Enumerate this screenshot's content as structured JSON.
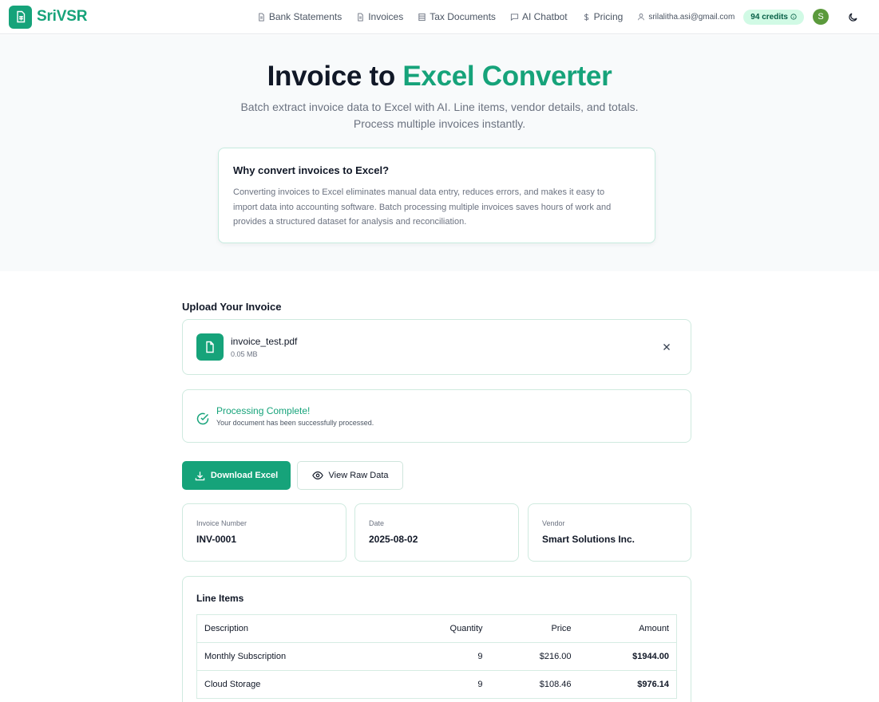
{
  "brand": {
    "name": "SriVSR"
  },
  "nav": {
    "links": [
      {
        "label": "Bank Statements",
        "icon": "document-icon"
      },
      {
        "label": "Invoices",
        "icon": "document-icon"
      },
      {
        "label": "Tax Documents",
        "icon": "table-icon"
      },
      {
        "label": "AI Chatbot",
        "icon": "chat-icon"
      },
      {
        "label": "Pricing",
        "icon": "dollar-icon"
      }
    ],
    "user_email": "srilalitha.asi@gmail.com",
    "credits": "94 credits",
    "avatar_initial": "S"
  },
  "hero": {
    "title_prefix": "Invoice to ",
    "title_accent": "Excel Converter",
    "subtitle_line1": "Batch extract invoice data to Excel with AI. Line items, vendor details, and totals.",
    "subtitle_line2": "Process multiple invoices instantly."
  },
  "why": {
    "title": "Why convert invoices to Excel?",
    "line1": "Converting invoices to Excel eliminates manual data entry, reduces errors, and makes it easy to",
    "line2": "import data into accounting software. Batch processing multiple invoices saves hours of work and",
    "line3": "provides a structured dataset for analysis and reconciliation."
  },
  "upload": {
    "label": "Upload Your Invoice",
    "file_name": "invoice_test.pdf",
    "file_size": "0.05 MB"
  },
  "status": {
    "title": "Processing Complete!",
    "description": "Your document has been successfully processed."
  },
  "actions": {
    "download_label": "Download Excel",
    "view_raw_label": "View Raw Data"
  },
  "invoice": {
    "number_label": "Invoice Number",
    "number": "INV-0001",
    "date_label": "Date",
    "date": "2025-08-02",
    "vendor_label": "Vendor",
    "vendor": "Smart Solutions Inc."
  },
  "line_items": {
    "title": "Line Items",
    "headers": [
      "Description",
      "Quantity",
      "Price",
      "Amount"
    ],
    "rows": [
      [
        "Monthly Subscription",
        "9",
        "$216.00",
        "$1944.00"
      ],
      [
        "Cloud Storage",
        "9",
        "$108.46",
        "$976.14"
      ]
    ]
  },
  "colors": {
    "accent": "#16a37a",
    "credits_bg": "#d1fae5"
  }
}
